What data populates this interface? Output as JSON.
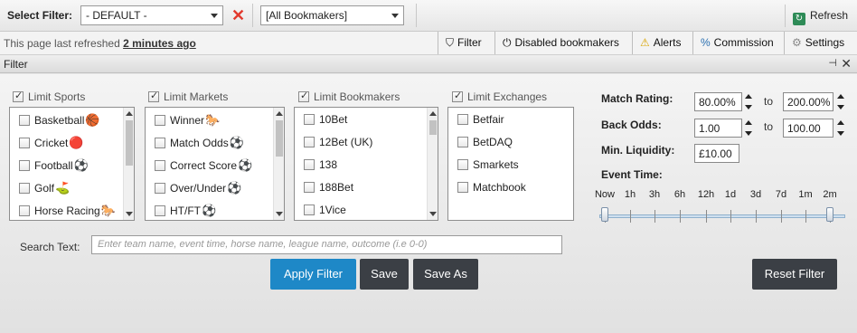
{
  "toolbar": {
    "select_filter_label": "Select Filter:",
    "filter_value": "- DEFAULT -",
    "bookmakers_value": "[All Bookmakers]",
    "refresh_label": "Refresh"
  },
  "statusbar": {
    "refreshed_prefix": "This page last refreshed",
    "refreshed_time": "2 minutes ago",
    "buttons": [
      {
        "label": "Filter",
        "icon": "filter-icon"
      },
      {
        "label": "Disabled bookmakers",
        "icon": "power-icon"
      },
      {
        "label": "Alerts",
        "icon": "warning-icon"
      },
      {
        "label": "Commission",
        "icon": "percent-icon"
      },
      {
        "label": "Settings",
        "icon": "gear-icon"
      }
    ]
  },
  "panel": {
    "title": "Filter"
  },
  "groups": {
    "sports": {
      "title": "Limit Sports",
      "checked": true,
      "items": [
        "Basketball",
        "Cricket",
        "Football",
        "Golf",
        "Horse Racing"
      ]
    },
    "markets": {
      "title": "Limit Markets",
      "checked": true,
      "items": [
        "Winner",
        "Match Odds",
        "Correct Score",
        "Over/Under",
        "HT/FT"
      ]
    },
    "bookmakers": {
      "title": "Limit Bookmakers",
      "checked": true,
      "items": [
        "10Bet",
        "12Bet (UK)",
        "138",
        "188Bet",
        "1Vice"
      ]
    },
    "exchanges": {
      "title": "Limit Exchanges",
      "checked": true,
      "items": [
        "Betfair",
        "BetDAQ",
        "Smarkets",
        "Matchbook"
      ]
    }
  },
  "ranges": {
    "match_rating_label": "Match Rating:",
    "match_rating_from": "80.00%",
    "match_rating_to": "200.00%",
    "back_odds_label": "Back Odds:",
    "back_odds_from": "1.00",
    "back_odds_to": "100.00",
    "to_label": "to",
    "min_liquidity_label": "Min. Liquidity:",
    "min_liquidity_value": "£10.00",
    "event_time_label": "Event Time:",
    "event_time_ticks": [
      "Now",
      "1h",
      "3h",
      "6h",
      "12h",
      "1d",
      "3d",
      "7d",
      "1m",
      "2m"
    ],
    "event_time_selected": [
      "Now",
      "2m"
    ]
  },
  "search": {
    "label": "Search Text:",
    "placeholder": "Enter team name, event time, horse name, league name, outcome (i.e 0-0)"
  },
  "actions": {
    "apply": "Apply Filter",
    "save": "Save",
    "save_as": "Save As",
    "reset": "Reset Filter"
  },
  "colors": {
    "apply_bg": "#1e88c7",
    "dark_btn_bg": "#3b3f45",
    "close_red": "#e23a2e"
  }
}
